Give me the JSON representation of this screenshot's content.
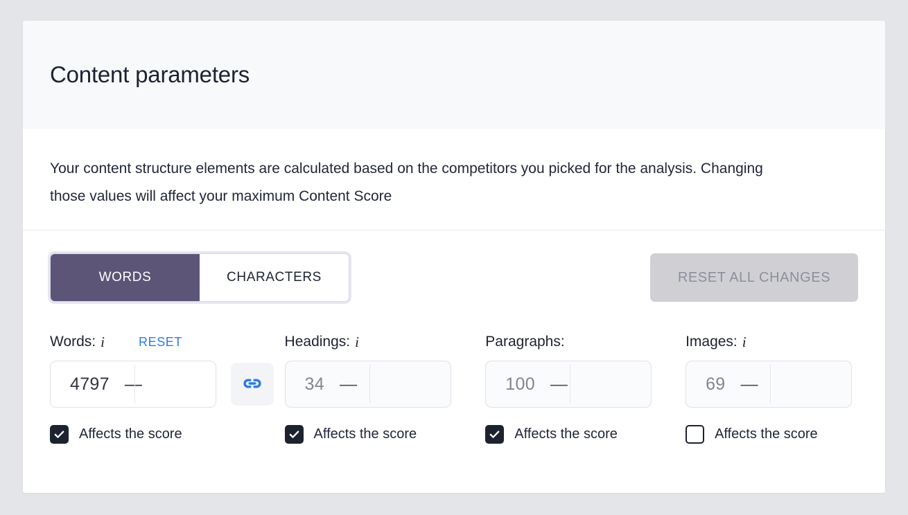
{
  "card": {
    "title": "Content parameters",
    "description": "Your content structure elements are calculated based on the competitors you picked for the analysis. Changing those values will affect your maximum Content Score"
  },
  "toolbar": {
    "segments": [
      {
        "label": "WORDS",
        "active": true
      },
      {
        "label": "CHARACTERS",
        "active": false
      }
    ],
    "reset_all_label": "RESET ALL CHANGES",
    "link_icon_name": "chain-link-icon",
    "accent_purple": "#5c5578",
    "accent_blue": "#2a7de1",
    "disabled_gray": "#d0d0d4"
  },
  "fields": [
    {
      "label": "Words:",
      "has_info_icon": true,
      "info_icon_name": "info-italic-icon",
      "reset_label": "RESET",
      "value": "4797",
      "dash": "—",
      "dimmed": false,
      "checkbox_label": "Affects the score",
      "checked": true
    },
    {
      "label": "Headings:",
      "has_info_icon": true,
      "info_icon_name": "info-italic-icon",
      "value": "34",
      "dash": "—",
      "dimmed": true,
      "checkbox_label": "Affects the score",
      "checked": true
    },
    {
      "label": "Paragraphs:",
      "has_info_icon": false,
      "value": "100",
      "dash": "—",
      "dimmed": true,
      "checkbox_label": "Affects the score",
      "checked": true
    },
    {
      "label": "Images:",
      "has_info_icon": true,
      "info_icon_name": "info-italic-icon",
      "value": "69",
      "dash": "—",
      "dimmed": true,
      "checkbox_label": "Affects the score",
      "checked": false
    }
  ]
}
